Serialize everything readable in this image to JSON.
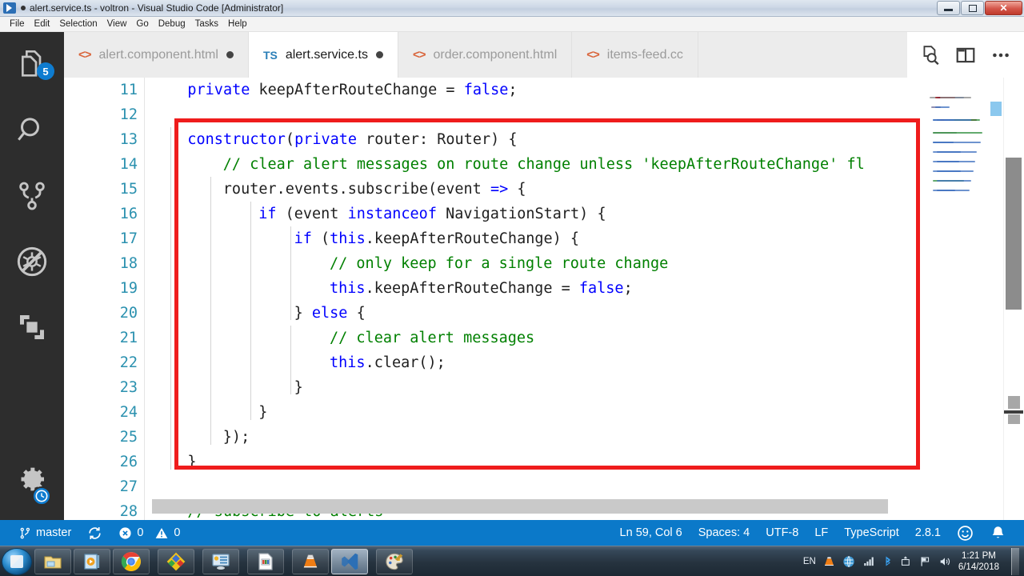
{
  "window": {
    "title": "alert.service.ts - voltron - Visual Studio Code [Administrator]",
    "dirty_dot": "●",
    "minimize_label": "Minimize",
    "restore_label": "Restore",
    "close_label": "✕",
    "logo_icon": "vscode-logo-icon"
  },
  "menubar": {
    "items": [
      {
        "label": "File"
      },
      {
        "label": "Edit"
      },
      {
        "label": "Selection"
      },
      {
        "label": "View"
      },
      {
        "label": "Go"
      },
      {
        "label": "Debug"
      },
      {
        "label": "Tasks"
      },
      {
        "label": "Help"
      }
    ]
  },
  "activitybar": {
    "items": [
      {
        "name": "explorer",
        "icon": "files-icon",
        "badge": "5"
      },
      {
        "name": "search",
        "icon": "search-icon",
        "badge": ""
      },
      {
        "name": "source-control",
        "icon": "source-control-icon",
        "badge": ""
      },
      {
        "name": "debug",
        "icon": "no-debug-icon",
        "badge": ""
      },
      {
        "name": "extensions",
        "icon": "extensions-icon",
        "badge": ""
      }
    ],
    "manage": {
      "icon": "gear-icon",
      "badge_icon": "clock-badge-icon"
    }
  },
  "tabs": [
    {
      "label": "alert.component.html",
      "icon": "html-file-icon",
      "dirty": true,
      "active": false,
      "truncated": false
    },
    {
      "label": "alert.service.ts",
      "icon": "ts-file-icon",
      "icon_text": "TS",
      "dirty": true,
      "active": true,
      "truncated": false
    },
    {
      "label": "order.component.html",
      "icon": "html-file-icon",
      "dirty": false,
      "active": false,
      "truncated": false
    },
    {
      "label": "items-feed.cc",
      "icon": "html-file-icon",
      "dirty": false,
      "active": false,
      "truncated": true
    }
  ],
  "editor_actions": [
    {
      "name": "open-preview",
      "icon": "preview-icon"
    },
    {
      "name": "split-editor",
      "icon": "split-editor-icon"
    },
    {
      "name": "more-actions",
      "icon": "ellipsis-icon"
    }
  ],
  "editor": {
    "language": "TypeScript",
    "first_visible_line": 11,
    "lines": [
      {
        "num": "11",
        "indent": 4,
        "tokens": [
          {
            "t": "private ",
            "c": "kw"
          },
          {
            "t": "keepAfterRouteChange = ",
            "c": ""
          },
          {
            "t": "false",
            "c": "kw"
          },
          {
            "t": ";",
            "c": ""
          }
        ]
      },
      {
        "num": "12",
        "indent": 0,
        "tokens": []
      },
      {
        "num": "13",
        "indent": 4,
        "tokens": [
          {
            "t": "constructor",
            "c": "kw"
          },
          {
            "t": "(",
            "c": ""
          },
          {
            "t": "private ",
            "c": "kw"
          },
          {
            "t": "router: Router) {",
            "c": ""
          }
        ]
      },
      {
        "num": "14",
        "indent": 8,
        "tokens": [
          {
            "t": "// clear alert messages on route change unless 'keepAfterRouteChange' fl",
            "c": "cm"
          }
        ]
      },
      {
        "num": "15",
        "indent": 8,
        "tokens": [
          {
            "t": "router.events.subscribe(event ",
            "c": ""
          },
          {
            "t": "=>",
            "c": "kw"
          },
          {
            "t": " {",
            "c": ""
          }
        ]
      },
      {
        "num": "16",
        "indent": 12,
        "tokens": [
          {
            "t": "if",
            "c": "kw"
          },
          {
            "t": " (event ",
            "c": ""
          },
          {
            "t": "instanceof",
            "c": "kw"
          },
          {
            "t": " NavigationStart) {",
            "c": ""
          }
        ]
      },
      {
        "num": "17",
        "indent": 16,
        "tokens": [
          {
            "t": "if",
            "c": "kw"
          },
          {
            "t": " (",
            "c": ""
          },
          {
            "t": "this",
            "c": "kw"
          },
          {
            "t": ".keepAfterRouteChange) {",
            "c": ""
          }
        ]
      },
      {
        "num": "18",
        "indent": 20,
        "tokens": [
          {
            "t": "// only keep for a single route change",
            "c": "cm"
          }
        ]
      },
      {
        "num": "19",
        "indent": 20,
        "tokens": [
          {
            "t": "this",
            "c": "kw"
          },
          {
            "t": ".keepAfterRouteChange = ",
            "c": ""
          },
          {
            "t": "false",
            "c": "kw"
          },
          {
            "t": ";",
            "c": ""
          }
        ]
      },
      {
        "num": "20",
        "indent": 16,
        "tokens": [
          {
            "t": "} ",
            "c": ""
          },
          {
            "t": "else",
            "c": "kw"
          },
          {
            "t": " {",
            "c": ""
          }
        ]
      },
      {
        "num": "21",
        "indent": 20,
        "tokens": [
          {
            "t": "// clear alert messages",
            "c": "cm"
          }
        ]
      },
      {
        "num": "22",
        "indent": 20,
        "tokens": [
          {
            "t": "this",
            "c": "kw"
          },
          {
            "t": ".clear();",
            "c": ""
          }
        ]
      },
      {
        "num": "23",
        "indent": 16,
        "tokens": [
          {
            "t": "}",
            "c": ""
          }
        ]
      },
      {
        "num": "24",
        "indent": 12,
        "tokens": [
          {
            "t": "}",
            "c": ""
          }
        ]
      },
      {
        "num": "25",
        "indent": 8,
        "tokens": [
          {
            "t": "});",
            "c": ""
          }
        ]
      },
      {
        "num": "26",
        "indent": 4,
        "tokens": [
          {
            "t": "}",
            "c": ""
          }
        ]
      },
      {
        "num": "27",
        "indent": 0,
        "tokens": []
      },
      {
        "num": "28",
        "indent": 4,
        "tokens": [
          {
            "t": "// subscribe to alerts",
            "c": "cm"
          }
        ]
      }
    ],
    "annotation": {
      "name": "red-highlight-box",
      "color": "#ef1c1c"
    }
  },
  "statusbar": {
    "branch_icon": "source-control-icon",
    "branch": "master",
    "sync_icon": "sync-icon",
    "error_icon": "error-icon",
    "errors": "0",
    "warning_icon": "warning-icon",
    "warnings": "0",
    "cursor": "Ln 59, Col 6",
    "indentation": "Spaces: 4",
    "encoding": "UTF-8",
    "eol": "LF",
    "language": "TypeScript",
    "language_version": "2.8.1",
    "feedback_icon": "smiley-icon",
    "notifications_icon": "bell-icon",
    "accent_color": "#0b79c9"
  },
  "taskbar": {
    "start_label": "Start",
    "buttons": [
      {
        "name": "file-explorer",
        "icon": "folder-icon"
      },
      {
        "name": "media-player",
        "icon": "media-player-icon"
      },
      {
        "name": "google-chrome",
        "icon": "chrome-icon"
      },
      {
        "name": "diamond-app",
        "icon": "diamond-app-icon"
      },
      {
        "name": "control-panel",
        "icon": "control-panel-icon"
      },
      {
        "name": "document-app",
        "icon": "document-icon"
      },
      {
        "name": "vlc-media-player",
        "icon": "vlc-cone-icon"
      },
      {
        "name": "visual-studio-code",
        "icon": "vscode-icon",
        "active": true
      },
      {
        "name": "paint",
        "icon": "paint-palette-icon"
      }
    ],
    "tray": {
      "language": "EN",
      "icons": [
        {
          "name": "vlc-tray",
          "icon": "vlc-cone-icon"
        },
        {
          "name": "network-globe",
          "icon": "globe-icon"
        },
        {
          "name": "signal-strength",
          "icon": "signal-bars-icon"
        },
        {
          "name": "bluetooth",
          "icon": "bluetooth-icon"
        },
        {
          "name": "safely-remove",
          "icon": "eject-device-icon"
        },
        {
          "name": "action-center",
          "icon": "flag-icon"
        },
        {
          "name": "volume",
          "icon": "speaker-icon"
        }
      ],
      "time": "1:21 PM",
      "date": "6/14/2018"
    }
  }
}
